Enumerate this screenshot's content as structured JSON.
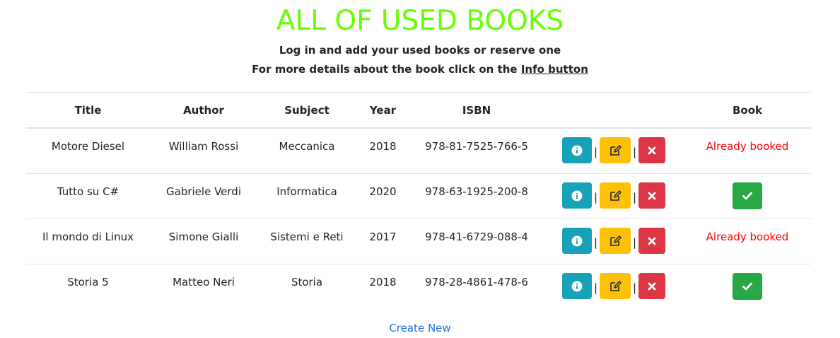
{
  "header": {
    "title": "ALL OF USED BOOKS",
    "subtitle_line1": "Log in and add your used books or reserve one",
    "subtitle_line2_prefix": "For more details about the book click on the",
    "subtitle_line2_link": "Info button"
  },
  "table": {
    "columns": [
      "Title",
      "Author",
      "Subject",
      "Year",
      "ISBN",
      "",
      "Book"
    ],
    "rows": [
      {
        "title": "Motore Diesel",
        "author": "William Rossi",
        "subject": "Meccanica",
        "year": "2018",
        "isbn": "978-81-7525-766-5",
        "status": "Already booked"
      },
      {
        "title": "Tutto su C#",
        "author": "Gabriele Verdi",
        "subject": "Informatica",
        "year": "2020",
        "isbn": "978-63-1925-200-8",
        "status": ""
      },
      {
        "title": "Il mondo di Linux",
        "author": "Simone Gialli",
        "subject": "Sistemi e Reti",
        "year": "2017",
        "isbn": "978-41-6729-088-4",
        "status": "Already booked"
      },
      {
        "title": "Storia 5",
        "author": "Matteo Neri",
        "subject": "Storia",
        "year": "2018",
        "isbn": "978-28-4861-478-6",
        "status": ""
      }
    ],
    "separator": "|"
  },
  "footer": {
    "create_new_label": "Create New"
  },
  "icons": {
    "info": "info-circle-icon",
    "edit": "edit-icon",
    "delete": "close-icon",
    "book": "check-icon"
  },
  "colors": {
    "title": "#66ff00",
    "info_button": "#17a2b8",
    "edit_button": "#ffc107",
    "delete_button": "#dc3545",
    "book_button": "#28a745",
    "booked_text": "#ff0000",
    "link": "#2470dc"
  }
}
